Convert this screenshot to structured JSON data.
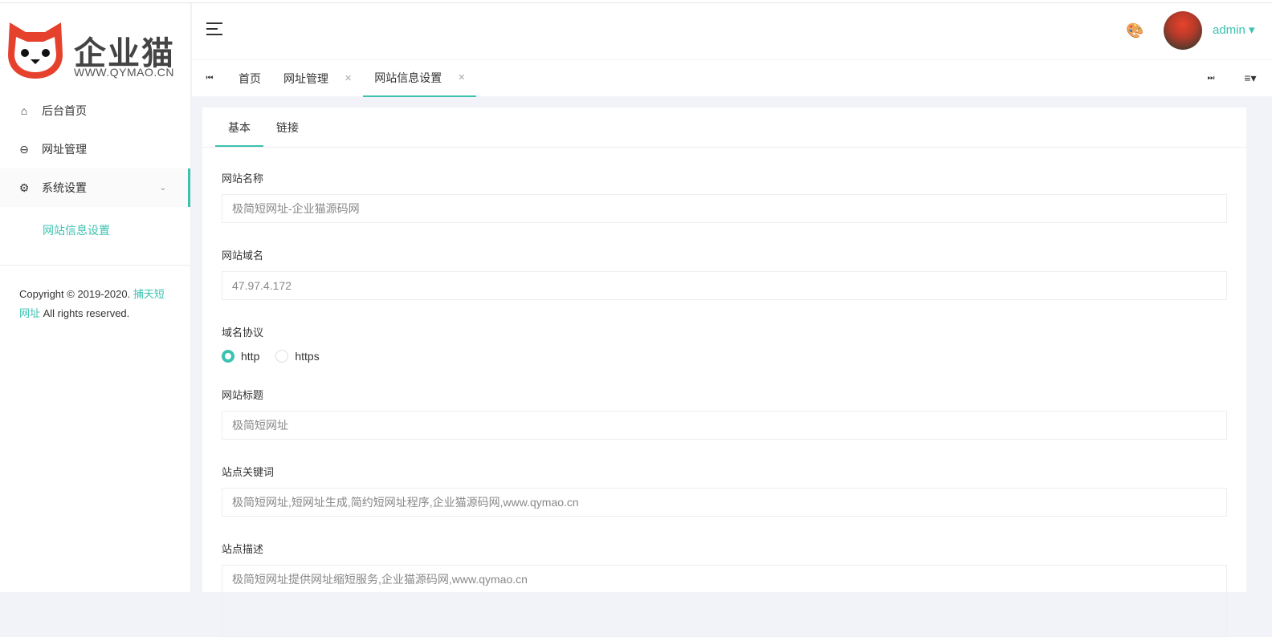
{
  "logo": {
    "name": "企业猫",
    "url": "WWW.QYMAO.CN"
  },
  "sidebar": {
    "items": [
      {
        "label": "后台首页",
        "icon": "home-icon"
      },
      {
        "label": "网址管理",
        "icon": "link-icon"
      },
      {
        "label": "系统设置",
        "icon": "gear-icon"
      }
    ],
    "sub_item": "网站信息设置"
  },
  "copyright": {
    "prefix": "Copyright © 2019-2020. ",
    "link": "捕天短网址",
    "suffix": " All rights reserved."
  },
  "header": {
    "user": "admin"
  },
  "tabs": [
    {
      "label": "首页"
    },
    {
      "label": "网址管理"
    },
    {
      "label": "网站信息设置"
    }
  ],
  "card": {
    "tabs": [
      "基本",
      "链接"
    ]
  },
  "form": {
    "site_name": {
      "label": "网站名称",
      "placeholder": "极简短网址-企业猫源码网"
    },
    "domain": {
      "label": "网站域名",
      "value": "47.97.4.172"
    },
    "protocol": {
      "label": "域名协议",
      "options": [
        "http",
        "https"
      ],
      "selected": "http"
    },
    "title": {
      "label": "网站标题",
      "placeholder": "极简短网址"
    },
    "keywords": {
      "label": "站点关键词",
      "placeholder": "极简短网址,短网址生成,简约短网址程序,企业猫源码网,www.qymao.cn"
    },
    "description": {
      "label": "站点描述",
      "placeholder": "极简短网址提供网址缩短服务,企业猫源码网,www.qymao.cn"
    }
  },
  "colors": {
    "accent": "#3cc2b0",
    "logo_red": "#e5412d"
  }
}
